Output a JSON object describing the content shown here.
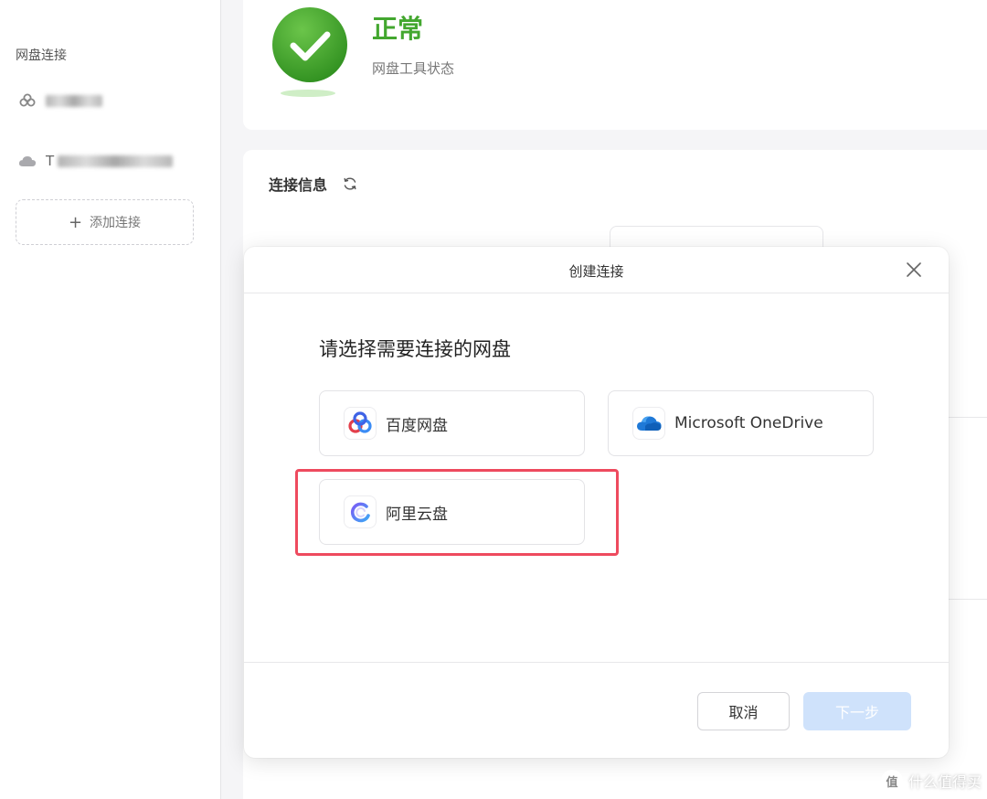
{
  "sidebar": {
    "title": "网盘连接",
    "items": [
      {
        "icon": "baidu-link-icon",
        "label_prefix": ""
      },
      {
        "icon": "cloud-icon",
        "label_prefix": "T"
      }
    ],
    "add_label": "添加连接"
  },
  "status": {
    "title": "正常",
    "subtitle": "网盘工具状态",
    "color": "#43a72f"
  },
  "info": {
    "title": "连接信息"
  },
  "dialog": {
    "title": "创建连接",
    "prompt": "请选择需要连接的网盘",
    "options": [
      {
        "label": "百度网盘",
        "icon": "baidu-netdisk-logo"
      },
      {
        "label": "Microsoft OneDrive",
        "icon": "onedrive-logo"
      },
      {
        "label": "阿里云盘",
        "icon": "aliyun-drive-logo"
      }
    ],
    "cancel_label": "取消",
    "next_label": "下一步",
    "highlight_color": "#ee4a5e"
  },
  "watermark": {
    "badge": "值",
    "text": "什么值得买"
  }
}
